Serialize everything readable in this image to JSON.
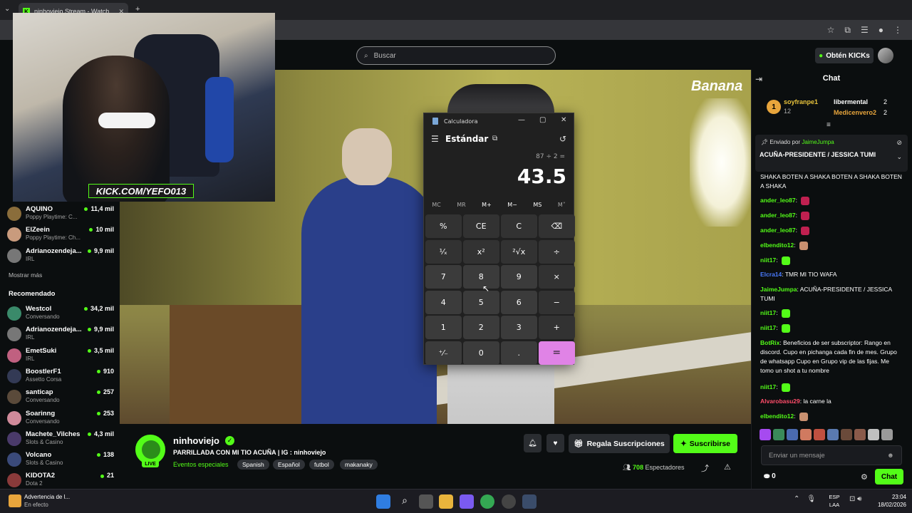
{
  "browser": {
    "tab_title": "ninhoviejo Stream - Watch",
    "tab_favicon": "kick-logo",
    "toolbar_icons": [
      "star-icon",
      "extensions-icon",
      "media-icon",
      "profile-icon",
      "menu-icon"
    ]
  },
  "header": {
    "search_placeholder": "Buscar",
    "get_kicks_label": "Obtén KICKs"
  },
  "webcam": {
    "url_overlay": "KICK.COM/YEFO013"
  },
  "sidebar": {
    "following_items": [
      {
        "name": "AQUINO",
        "sub": "Poppy Playtime: C...",
        "viewers": "11,4 mil",
        "color": "#8a6d3b"
      },
      {
        "name": "ElZeein",
        "sub": "Poppy Playtime: Ch...",
        "viewers": "10 mil",
        "color": "#c99b7d"
      },
      {
        "name": "Adrianozendeja...",
        "sub": "IRL",
        "viewers": "9,9 mil",
        "color": "#777777"
      }
    ],
    "show_more": "Mostrar más",
    "recommended_heading": "Recomendado",
    "recommended_items": [
      {
        "name": "Westcol",
        "sub": "Conversando",
        "viewers": "34,2 mil",
        "color": "#3a8a6a"
      },
      {
        "name": "Adrianozendeja...",
        "sub": "IRL",
        "viewers": "9,9 mil",
        "color": "#777777"
      },
      {
        "name": "EmetSuki",
        "sub": "IRL",
        "viewers": "3,5 mil",
        "color": "#c06080"
      },
      {
        "name": "BoostlerF1",
        "sub": "Assetto Corsa",
        "viewers": "910",
        "color": "#333a55"
      },
      {
        "name": "santicap",
        "sub": "Conversando",
        "viewers": "257",
        "color": "#5a4a3a"
      },
      {
        "name": "Soarinng",
        "sub": "Conversando",
        "viewers": "253",
        "color": "#d08a9a"
      },
      {
        "name": "Machete_Vilches",
        "sub": "Slots & Casino",
        "viewers": "4,3 mil",
        "color": "#4a3a6a"
      },
      {
        "name": "Volcano",
        "sub": "Slots & Casino",
        "viewers": "138",
        "color": "#3a4a7a"
      },
      {
        "name": "KIDOTA2",
        "sub": "Dota 2",
        "viewers": "21",
        "color": "#8a3a3a"
      }
    ]
  },
  "video": {
    "logo_text": "Banana"
  },
  "calculator": {
    "title": "Calculadora",
    "mode": "Estándar",
    "expression": "87 ÷ 2 =",
    "display": "43.5",
    "memory_keys": [
      "MC",
      "MR",
      "M+",
      "M−",
      "MS",
      "M˅"
    ],
    "keys": [
      "%",
      "CE",
      "C",
      "⌫",
      "¹⁄ₓ",
      "x²",
      "²√x",
      "÷",
      "7",
      "8",
      "9",
      "×",
      "4",
      "5",
      "6",
      "−",
      "1",
      "2",
      "3",
      "+",
      "⁺⁄₋",
      "0",
      ".",
      "="
    ]
  },
  "stream": {
    "streamer": "ninhoviejo",
    "live_badge": "LIVE",
    "title": "PARRILLADA CON MI TIO ACUÑA | IG : ninhoviejo",
    "category": "Eventos especiales",
    "tags": [
      "Spanish",
      "Español",
      "futbol",
      "makanaky"
    ],
    "gift_label": "Regala Suscripciones",
    "subscribe_label": "Suscribirse",
    "viewer_count": "708",
    "viewer_label": "Espectadores"
  },
  "chat": {
    "title": "Chat",
    "top_gifters": [
      {
        "rank": "1",
        "name": "soyfranpe1",
        "count": "12"
      },
      {
        "name": "libermental",
        "count": "2"
      },
      {
        "name": "Medicenvero2",
        "count": "2"
      }
    ],
    "pinned_by_prefix": "Enviado por",
    "pinned_by_user": "JaimeJumpa",
    "pinned_message": "ACUÑA-PRESIDENTE / JESSICA TUMI",
    "messages": [
      {
        "user": "",
        "text": "SHAKA BOTEN A SHAKA BOTEN A SHAKA BOTEN A SHAKA",
        "color": "#ffffff"
      },
      {
        "user": "ander_leo87",
        "text": "",
        "color": "#53fc18"
      },
      {
        "user": "ander_leo87",
        "text": "",
        "color": "#53fc18"
      },
      {
        "user": "ander_leo87",
        "text": "",
        "color": "#53fc18"
      },
      {
        "user": "elbendito12",
        "text": "",
        "color": "#53fc18"
      },
      {
        "user": "niit17",
        "text": "",
        "color": "#53fc18"
      },
      {
        "user": "Elcra14",
        "text": "TMR MI TIO WAFA",
        "color": "#4a7bff"
      },
      {
        "user": "JaimeJumpa",
        "text": "ACUÑA-PRESIDENTE / JESSICA TUMI",
        "color": "#53fc18"
      },
      {
        "user": "niit17",
        "text": "",
        "color": "#53fc18"
      },
      {
        "user": "niit17",
        "text": "",
        "color": "#53fc18"
      },
      {
        "user": "BotRix",
        "text": "Beneficios de ser subscriptor: Rango en discord. Cupo en pichanga cada fin de mes. Grupo de whatsapp Cupo en Grupo vip de las fijas. Me tomo un shot a tu nombre",
        "color": "#53fc18"
      },
      {
        "user": "niit17",
        "text": "",
        "color": "#53fc18"
      },
      {
        "user": "Alvarobasu29",
        "text": "la carne  la",
        "color": "#ff4d6a"
      },
      {
        "user": "elbendito12",
        "text": "",
        "color": "#53fc18"
      }
    ],
    "input_placeholder": "Enviar un mensaje",
    "kicks_count": "0",
    "send_label": "Chat"
  },
  "taskbar": {
    "warning_title": "Advertencia de l...",
    "warning_sub": "En efecto",
    "lang_line1": "ESP",
    "lang_line2": "LAA",
    "time": "23:04",
    "date": "18/02/2026"
  }
}
